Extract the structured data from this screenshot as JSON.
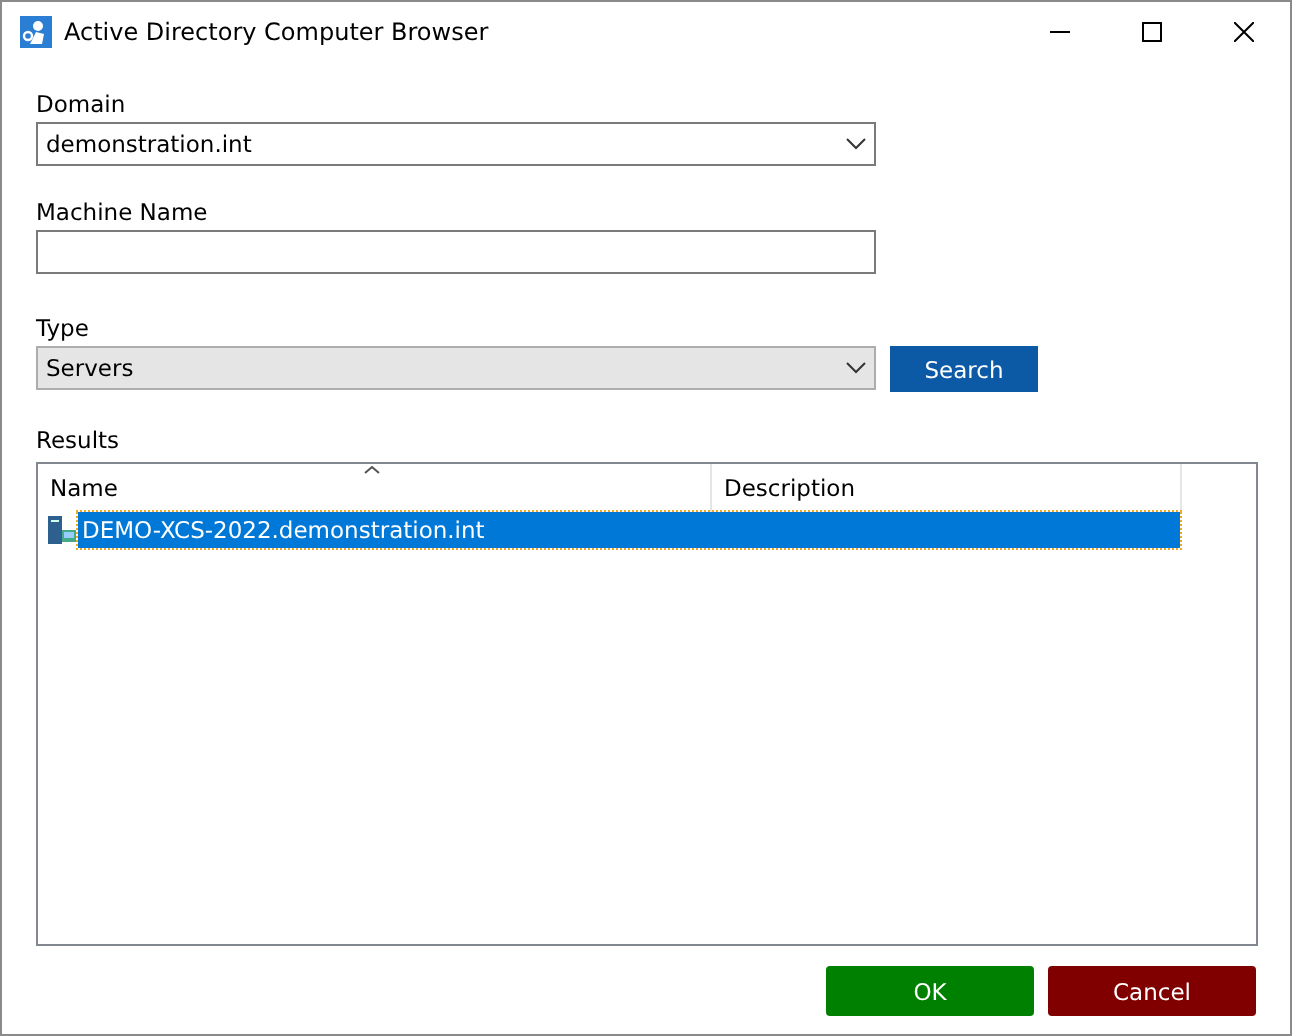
{
  "window": {
    "title": "Active Directory Computer Browser"
  },
  "domain": {
    "label": "Domain",
    "value": "demonstration.int"
  },
  "machine_name": {
    "label": "Machine Name"
  },
  "type": {
    "label": "Type",
    "value": "Servers"
  },
  "search_button": "Search",
  "results": {
    "label": "Results",
    "columns": [
      "Name",
      "Description"
    ],
    "rows": [
      {
        "name": "DEMO-XCS-2022.demonstration.int",
        "description": "",
        "selected": true
      }
    ]
  },
  "buttons": [
    "OK",
    "Cancel"
  ]
}
